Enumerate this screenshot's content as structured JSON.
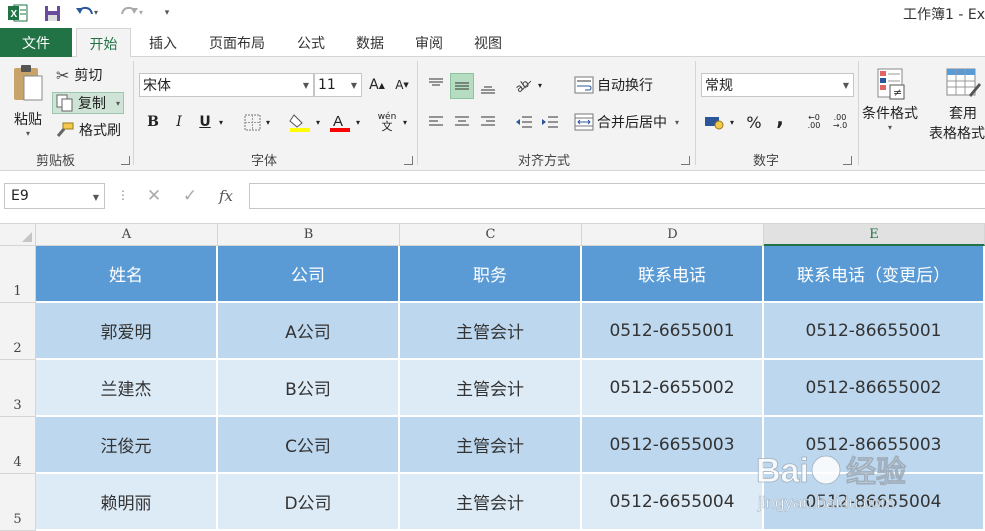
{
  "title_bar": {
    "window_title": "工作簿1 - Ex"
  },
  "tabs": {
    "file": "文件",
    "items": [
      "开始",
      "插入",
      "页面布局",
      "公式",
      "数据",
      "审阅",
      "视图"
    ],
    "active_index": 0
  },
  "ribbon": {
    "clipboard": {
      "paste": "粘贴",
      "cut": "剪切",
      "copy": "复制",
      "format_painter": "格式刷",
      "group_label": "剪贴板"
    },
    "font": {
      "font_name": "宋体",
      "font_size": "11",
      "bold": "B",
      "italic": "I",
      "underline": "U",
      "phonetic": "wén",
      "group_label": "字体"
    },
    "alignment": {
      "wrap_text": "自动换行",
      "merge_center": "合并后居中",
      "group_label": "对齐方式"
    },
    "number": {
      "format": "常规",
      "percent": "%",
      "comma": ",",
      "group_label": "数字"
    },
    "styles": {
      "conditional_formatting": "条件格式",
      "format_as_table_line1": "套用",
      "format_as_table_line2": "表格格式"
    }
  },
  "formula_bar": {
    "name_box": "E9",
    "fx": "fx",
    "formula": ""
  },
  "sheet": {
    "columns": [
      "A",
      "B",
      "C",
      "D",
      "E"
    ],
    "selected_column": "E",
    "rows": [
      "1",
      "2",
      "3",
      "4",
      "5"
    ],
    "header": [
      "姓名",
      "公司",
      "职务",
      "联系电话",
      "联系电话（变更后）"
    ],
    "data": [
      [
        "郭爱明",
        "A公司",
        "主管会计",
        "0512-6655001",
        "0512-86655001"
      ],
      [
        "兰建杰",
        "B公司",
        "主管会计",
        "0512-6655002",
        "0512-86655002"
      ],
      [
        "汪俊元",
        "C公司",
        "主管会计",
        "0512-6655003",
        "0512-86655003"
      ],
      [
        "赖明丽",
        "D公司",
        "主管会计",
        "0512-6655004",
        "0512-86655004"
      ]
    ]
  },
  "watermark": {
    "brand": "Bai",
    "brand_cn": "经验",
    "url": "jingyan.baidu.com"
  },
  "colors": {
    "excel_green": "#217346",
    "header_fill": "#5b9bd5",
    "band_dark": "#bdd7ee",
    "band_light": "#ddebf7"
  }
}
